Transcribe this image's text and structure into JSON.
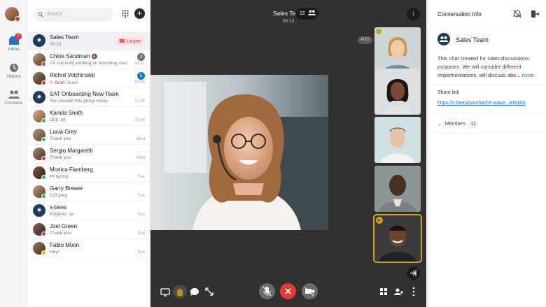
{
  "rail": {
    "items": [
      {
        "label": "Inbox",
        "badge": "7"
      },
      {
        "label": "History"
      },
      {
        "label": "Contacts"
      }
    ]
  },
  "list": {
    "search_placeholder": "Search",
    "add_label": "+",
    "conversations": [
      {
        "name": "Sales Team",
        "preview": "05:13",
        "action": "Leave"
      },
      {
        "name": "Chloe Sandman",
        "preview": "I'm currently working on Incoming messages",
        "unread": "2",
        "time": "12:11"
      },
      {
        "name": "Richrd Volchinskiii",
        "draft_label": "Draft:",
        "preview": "Sure!",
        "unread": "5",
        "time": "12:01"
      },
      {
        "name": "SAT Onboarding New Team",
        "preview": "You created this group today.",
        "time": "11:05"
      },
      {
        "name": "Kamila Smith",
        "preview": "Ohh, ok",
        "time": "11:04"
      },
      {
        "name": "Lucia Grey",
        "preview": "Thank you",
        "time": "Wed"
      },
      {
        "name": "Sergio Margaretti",
        "preview": "Thank you",
        "time": "Wed"
      },
      {
        "name": "Monica Flamberg",
        "preview": "typing",
        "time": "Tue"
      },
      {
        "name": "Garry Brewer",
        "preview": "123.jpeg",
        "time": "Tue"
      },
      {
        "name": "x-bees",
        "preview": "Eugenio: ok",
        "time": "Sun"
      },
      {
        "name": "Joel Green",
        "preview": "Thank you",
        "time": "Sun"
      },
      {
        "name": "Fabio Moon",
        "preview": "Hey!",
        "time": "Sun"
      }
    ]
  },
  "stage": {
    "title": "Sales Team",
    "timer": "05:13",
    "participants": "12",
    "info_label": "i",
    "aud_label": "AUD"
  },
  "panel": {
    "header": "Conversation Info",
    "team_name": "Sales Team",
    "description": "This chat created for sales discussions purposes. We will consider different implementations, will discuss abo...",
    "more_label": "more",
    "share_link_label": "Share link",
    "share_link": "https://x-bees/joinchat/hFuqawr...ERpi65",
    "members_label": "Members",
    "members_count": "12"
  },
  "colors": {
    "accent": "#1976d2",
    "danger": "#e53935",
    "online": "#22c55e",
    "speaking": "#d4a017"
  }
}
